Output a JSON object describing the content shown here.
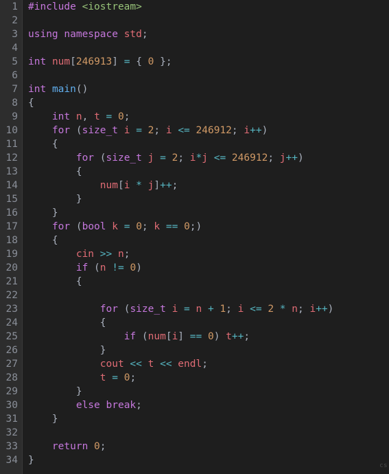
{
  "watermark": "cs",
  "line_count": 34,
  "code_lines": [
    [
      {
        "c": "tok-pp",
        "t": "#include"
      },
      {
        "c": "tok-punc",
        "t": " "
      },
      {
        "c": "tok-inc",
        "t": "<iostream>"
      }
    ],
    [],
    [
      {
        "c": "tok-kw",
        "t": "using"
      },
      {
        "c": "tok-punc",
        "t": " "
      },
      {
        "c": "tok-kw",
        "t": "namespace"
      },
      {
        "c": "tok-punc",
        "t": " "
      },
      {
        "c": "tok-var",
        "t": "std"
      },
      {
        "c": "tok-punc",
        "t": ";"
      }
    ],
    [],
    [
      {
        "c": "tok-type",
        "t": "int"
      },
      {
        "c": "tok-punc",
        "t": " "
      },
      {
        "c": "tok-var",
        "t": "num"
      },
      {
        "c": "tok-punc",
        "t": "["
      },
      {
        "c": "tok-num",
        "t": "246913"
      },
      {
        "c": "tok-punc",
        "t": "] "
      },
      {
        "c": "tok-op",
        "t": "="
      },
      {
        "c": "tok-punc",
        "t": " { "
      },
      {
        "c": "tok-num",
        "t": "0"
      },
      {
        "c": "tok-punc",
        "t": " };"
      }
    ],
    [],
    [
      {
        "c": "tok-type",
        "t": "int"
      },
      {
        "c": "tok-punc",
        "t": " "
      },
      {
        "c": "tok-fn",
        "t": "main"
      },
      {
        "c": "tok-punc",
        "t": "()"
      }
    ],
    [
      {
        "c": "tok-punc",
        "t": "{"
      }
    ],
    [
      {
        "c": "tok-punc",
        "t": "    "
      },
      {
        "c": "tok-type",
        "t": "int"
      },
      {
        "c": "tok-punc",
        "t": " "
      },
      {
        "c": "tok-var",
        "t": "n"
      },
      {
        "c": "tok-punc",
        "t": ", "
      },
      {
        "c": "tok-var",
        "t": "t"
      },
      {
        "c": "tok-punc",
        "t": " "
      },
      {
        "c": "tok-op",
        "t": "="
      },
      {
        "c": "tok-punc",
        "t": " "
      },
      {
        "c": "tok-num",
        "t": "0"
      },
      {
        "c": "tok-punc",
        "t": ";"
      }
    ],
    [
      {
        "c": "tok-punc",
        "t": "    "
      },
      {
        "c": "tok-kw",
        "t": "for"
      },
      {
        "c": "tok-punc",
        "t": " ("
      },
      {
        "c": "tok-type",
        "t": "size_t"
      },
      {
        "c": "tok-punc",
        "t": " "
      },
      {
        "c": "tok-var",
        "t": "i"
      },
      {
        "c": "tok-punc",
        "t": " "
      },
      {
        "c": "tok-op",
        "t": "="
      },
      {
        "c": "tok-punc",
        "t": " "
      },
      {
        "c": "tok-num",
        "t": "2"
      },
      {
        "c": "tok-punc",
        "t": "; "
      },
      {
        "c": "tok-var",
        "t": "i"
      },
      {
        "c": "tok-punc",
        "t": " "
      },
      {
        "c": "tok-op",
        "t": "<="
      },
      {
        "c": "tok-punc",
        "t": " "
      },
      {
        "c": "tok-num",
        "t": "246912"
      },
      {
        "c": "tok-punc",
        "t": "; "
      },
      {
        "c": "tok-var",
        "t": "i"
      },
      {
        "c": "tok-op",
        "t": "++"
      },
      {
        "c": "tok-punc",
        "t": ")"
      }
    ],
    [
      {
        "c": "tok-punc",
        "t": "    {"
      }
    ],
    [
      {
        "c": "tok-punc",
        "t": "        "
      },
      {
        "c": "tok-kw",
        "t": "for"
      },
      {
        "c": "tok-punc",
        "t": " ("
      },
      {
        "c": "tok-type",
        "t": "size_t"
      },
      {
        "c": "tok-punc",
        "t": " "
      },
      {
        "c": "tok-var",
        "t": "j"
      },
      {
        "c": "tok-punc",
        "t": " "
      },
      {
        "c": "tok-op",
        "t": "="
      },
      {
        "c": "tok-punc",
        "t": " "
      },
      {
        "c": "tok-num",
        "t": "2"
      },
      {
        "c": "tok-punc",
        "t": "; "
      },
      {
        "c": "tok-var",
        "t": "i"
      },
      {
        "c": "tok-op",
        "t": "*"
      },
      {
        "c": "tok-var",
        "t": "j"
      },
      {
        "c": "tok-punc",
        "t": " "
      },
      {
        "c": "tok-op",
        "t": "<="
      },
      {
        "c": "tok-punc",
        "t": " "
      },
      {
        "c": "tok-num",
        "t": "246912"
      },
      {
        "c": "tok-punc",
        "t": "; "
      },
      {
        "c": "tok-var",
        "t": "j"
      },
      {
        "c": "tok-op",
        "t": "++"
      },
      {
        "c": "tok-punc",
        "t": ")"
      }
    ],
    [
      {
        "c": "tok-punc",
        "t": "        {"
      }
    ],
    [
      {
        "c": "tok-punc",
        "t": "            "
      },
      {
        "c": "tok-var",
        "t": "num"
      },
      {
        "c": "tok-punc",
        "t": "["
      },
      {
        "c": "tok-var",
        "t": "i"
      },
      {
        "c": "tok-punc",
        "t": " "
      },
      {
        "c": "tok-op",
        "t": "*"
      },
      {
        "c": "tok-punc",
        "t": " "
      },
      {
        "c": "tok-var",
        "t": "j"
      },
      {
        "c": "tok-punc",
        "t": "]"
      },
      {
        "c": "tok-op",
        "t": "++"
      },
      {
        "c": "tok-punc",
        "t": ";"
      }
    ],
    [
      {
        "c": "tok-punc",
        "t": "        }"
      }
    ],
    [
      {
        "c": "tok-punc",
        "t": "    }"
      }
    ],
    [
      {
        "c": "tok-punc",
        "t": "    "
      },
      {
        "c": "tok-kw",
        "t": "for"
      },
      {
        "c": "tok-punc",
        "t": " ("
      },
      {
        "c": "tok-type",
        "t": "bool"
      },
      {
        "c": "tok-punc",
        "t": " "
      },
      {
        "c": "tok-var",
        "t": "k"
      },
      {
        "c": "tok-punc",
        "t": " "
      },
      {
        "c": "tok-op",
        "t": "="
      },
      {
        "c": "tok-punc",
        "t": " "
      },
      {
        "c": "tok-num",
        "t": "0"
      },
      {
        "c": "tok-punc",
        "t": "; "
      },
      {
        "c": "tok-var",
        "t": "k"
      },
      {
        "c": "tok-punc",
        "t": " "
      },
      {
        "c": "tok-op",
        "t": "=="
      },
      {
        "c": "tok-punc",
        "t": " "
      },
      {
        "c": "tok-num",
        "t": "0"
      },
      {
        "c": "tok-punc",
        "t": ";)"
      }
    ],
    [
      {
        "c": "tok-punc",
        "t": "    {"
      }
    ],
    [
      {
        "c": "tok-punc",
        "t": "        "
      },
      {
        "c": "tok-var",
        "t": "cin"
      },
      {
        "c": "tok-punc",
        "t": " "
      },
      {
        "c": "tok-op",
        "t": ">>"
      },
      {
        "c": "tok-punc",
        "t": " "
      },
      {
        "c": "tok-var",
        "t": "n"
      },
      {
        "c": "tok-punc",
        "t": ";"
      }
    ],
    [
      {
        "c": "tok-punc",
        "t": "        "
      },
      {
        "c": "tok-kw",
        "t": "if"
      },
      {
        "c": "tok-punc",
        "t": " ("
      },
      {
        "c": "tok-var",
        "t": "n"
      },
      {
        "c": "tok-punc",
        "t": " "
      },
      {
        "c": "tok-op",
        "t": "!="
      },
      {
        "c": "tok-punc",
        "t": " "
      },
      {
        "c": "tok-num",
        "t": "0"
      },
      {
        "c": "tok-punc",
        "t": ")"
      }
    ],
    [
      {
        "c": "tok-punc",
        "t": "        {"
      }
    ],
    [],
    [
      {
        "c": "tok-punc",
        "t": "            "
      },
      {
        "c": "tok-kw",
        "t": "for"
      },
      {
        "c": "tok-punc",
        "t": " ("
      },
      {
        "c": "tok-type",
        "t": "size_t"
      },
      {
        "c": "tok-punc",
        "t": " "
      },
      {
        "c": "tok-var",
        "t": "i"
      },
      {
        "c": "tok-punc",
        "t": " "
      },
      {
        "c": "tok-op",
        "t": "="
      },
      {
        "c": "tok-punc",
        "t": " "
      },
      {
        "c": "tok-var",
        "t": "n"
      },
      {
        "c": "tok-punc",
        "t": " "
      },
      {
        "c": "tok-op",
        "t": "+"
      },
      {
        "c": "tok-punc",
        "t": " "
      },
      {
        "c": "tok-num",
        "t": "1"
      },
      {
        "c": "tok-punc",
        "t": "; "
      },
      {
        "c": "tok-var",
        "t": "i"
      },
      {
        "c": "tok-punc",
        "t": " "
      },
      {
        "c": "tok-op",
        "t": "<="
      },
      {
        "c": "tok-punc",
        "t": " "
      },
      {
        "c": "tok-num",
        "t": "2"
      },
      {
        "c": "tok-punc",
        "t": " "
      },
      {
        "c": "tok-op",
        "t": "*"
      },
      {
        "c": "tok-punc",
        "t": " "
      },
      {
        "c": "tok-var",
        "t": "n"
      },
      {
        "c": "tok-punc",
        "t": "; "
      },
      {
        "c": "tok-var",
        "t": "i"
      },
      {
        "c": "tok-op",
        "t": "++"
      },
      {
        "c": "tok-punc",
        "t": ")"
      }
    ],
    [
      {
        "c": "tok-punc",
        "t": "            {"
      }
    ],
    [
      {
        "c": "tok-punc",
        "t": "                "
      },
      {
        "c": "tok-kw",
        "t": "if"
      },
      {
        "c": "tok-punc",
        "t": " ("
      },
      {
        "c": "tok-var",
        "t": "num"
      },
      {
        "c": "tok-punc",
        "t": "["
      },
      {
        "c": "tok-var",
        "t": "i"
      },
      {
        "c": "tok-punc",
        "t": "] "
      },
      {
        "c": "tok-op",
        "t": "=="
      },
      {
        "c": "tok-punc",
        "t": " "
      },
      {
        "c": "tok-num",
        "t": "0"
      },
      {
        "c": "tok-punc",
        "t": ") "
      },
      {
        "c": "tok-var",
        "t": "t"
      },
      {
        "c": "tok-op",
        "t": "++"
      },
      {
        "c": "tok-punc",
        "t": ";"
      }
    ],
    [
      {
        "c": "tok-punc",
        "t": "            }"
      }
    ],
    [
      {
        "c": "tok-punc",
        "t": "            "
      },
      {
        "c": "tok-var",
        "t": "cout"
      },
      {
        "c": "tok-punc",
        "t": " "
      },
      {
        "c": "tok-op",
        "t": "<<"
      },
      {
        "c": "tok-punc",
        "t": " "
      },
      {
        "c": "tok-var",
        "t": "t"
      },
      {
        "c": "tok-punc",
        "t": " "
      },
      {
        "c": "tok-op",
        "t": "<<"
      },
      {
        "c": "tok-punc",
        "t": " "
      },
      {
        "c": "tok-var",
        "t": "endl"
      },
      {
        "c": "tok-punc",
        "t": ";"
      }
    ],
    [
      {
        "c": "tok-punc",
        "t": "            "
      },
      {
        "c": "tok-var",
        "t": "t"
      },
      {
        "c": "tok-punc",
        "t": " "
      },
      {
        "c": "tok-op",
        "t": "="
      },
      {
        "c": "tok-punc",
        "t": " "
      },
      {
        "c": "tok-num",
        "t": "0"
      },
      {
        "c": "tok-punc",
        "t": ";"
      }
    ],
    [
      {
        "c": "tok-punc",
        "t": "        }"
      }
    ],
    [
      {
        "c": "tok-punc",
        "t": "        "
      },
      {
        "c": "tok-kw",
        "t": "else"
      },
      {
        "c": "tok-punc",
        "t": " "
      },
      {
        "c": "tok-kw",
        "t": "break"
      },
      {
        "c": "tok-punc",
        "t": ";"
      }
    ],
    [
      {
        "c": "tok-punc",
        "t": "    }"
      }
    ],
    [],
    [
      {
        "c": "tok-punc",
        "t": "    "
      },
      {
        "c": "tok-kw",
        "t": "return"
      },
      {
        "c": "tok-punc",
        "t": " "
      },
      {
        "c": "tok-num",
        "t": "0"
      },
      {
        "c": "tok-punc",
        "t": ";"
      }
    ],
    [
      {
        "c": "tok-punc",
        "t": "}"
      }
    ]
  ]
}
